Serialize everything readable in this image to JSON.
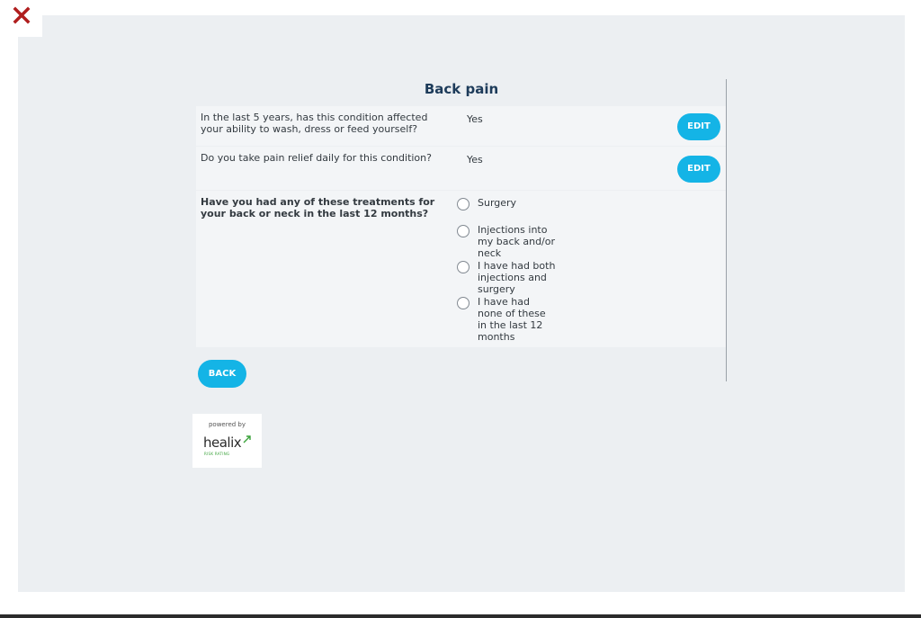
{
  "close_icon": "close-x-icon",
  "colors": {
    "accent": "#14b4e6",
    "close": "#b01e1e",
    "title": "#1d3b5a",
    "panel": "#eceff2",
    "row": "#f3f5f7",
    "brand_green": "#3aa23a"
  },
  "page_title": "Back pain",
  "questions": [
    {
      "text": "In the last 5 years, has this condition affected your ability to wash, dress or feed yourself?",
      "answer": "Yes",
      "edit_label": "EDIT"
    },
    {
      "text": "Do you take pain relief daily for this condition?",
      "answer": "Yes",
      "edit_label": "EDIT"
    }
  ],
  "treatment_question": {
    "text": "Have you had any of these treatments for your back or neck in the last 12 months?",
    "options": [
      "Surgery",
      "Injections into my back and/or neck",
      "I have had both injections and surgery",
      "I have had none of these in the last 12 months"
    ]
  },
  "back_label": "BACK",
  "branding": {
    "powered_by": "powered by",
    "logo_name": "healix",
    "logo_tagline": "RISK RATING"
  }
}
